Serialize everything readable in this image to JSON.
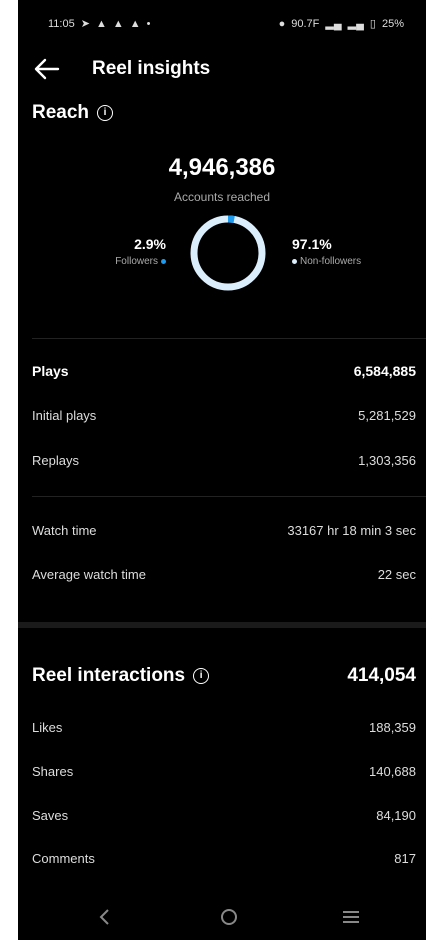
{
  "status_bar": {
    "time": "11:05",
    "signal": "90.7F",
    "battery": "25%"
  },
  "header": {
    "title": "Reel insights"
  },
  "reach": {
    "section_title": "Reach",
    "accounts_reached": "4,946,386",
    "accounts_reached_label": "Accounts reached",
    "followers_pct": "2.9%",
    "followers_label": "Followers",
    "followers_fraction": 0.029,
    "non_followers_pct": "97.1%",
    "non_followers_label": "Non-followers",
    "followers_color": "#1d9bf0",
    "non_followers_color": "#dbeefb"
  },
  "plays": {
    "label": "Plays",
    "value": "6,584,885",
    "initial_label": "Initial plays",
    "initial_value": "5,281,529",
    "replays_label": "Replays",
    "replays_value": "1,303,356"
  },
  "watch": {
    "watch_time_label": "Watch time",
    "watch_time_value": "33167 hr 18 min 3 sec",
    "avg_label": "Average watch time",
    "avg_value": "22 sec"
  },
  "interactions": {
    "section_title": "Reel interactions",
    "total": "414,054",
    "items": [
      {
        "label": "Likes",
        "value": "188,359"
      },
      {
        "label": "Shares",
        "value": "140,688"
      },
      {
        "label": "Saves",
        "value": "84,190"
      },
      {
        "label": "Comments",
        "value": "817"
      }
    ]
  },
  "nav": {
    "back_icon": "chevron-left-icon",
    "home_icon": "circle-icon",
    "menu_icon": "menu-lines-icon"
  }
}
